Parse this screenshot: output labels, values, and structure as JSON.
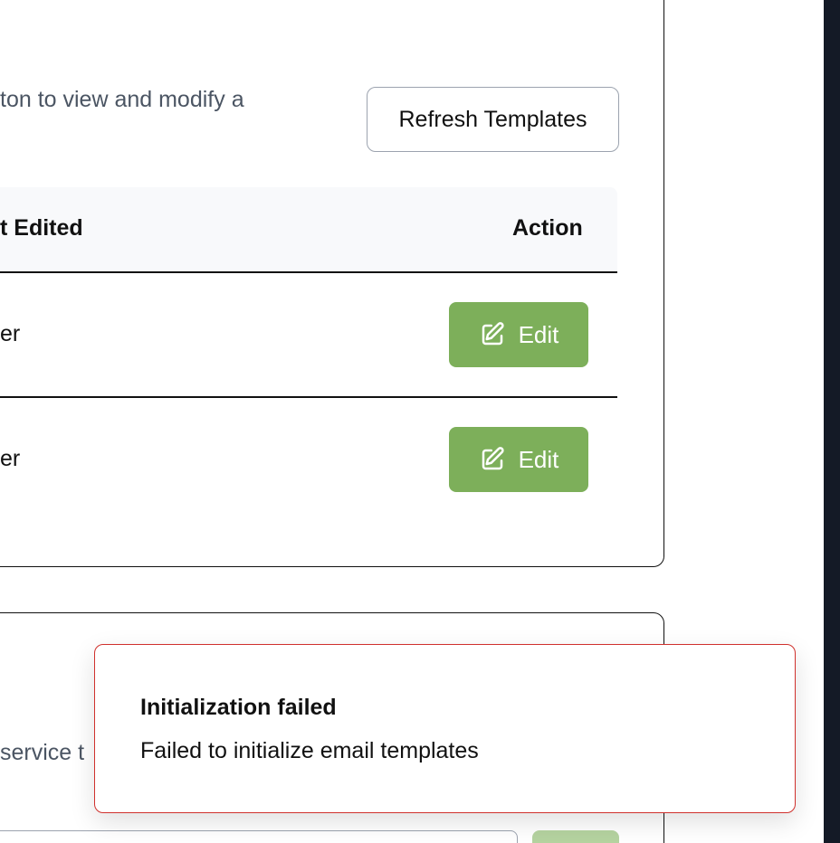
{
  "templates_card": {
    "description": "ton to view and modify a",
    "refresh_label": "Refresh Templates",
    "table": {
      "headers": {
        "last_edited": "t Edited",
        "action": "Action"
      },
      "rows": [
        {
          "last_edited": "er",
          "action_label": "Edit"
        },
        {
          "last_edited": "er",
          "action_label": "Edit"
        }
      ]
    }
  },
  "service_card": {
    "description": "service t"
  },
  "toast": {
    "title": "Initialization failed",
    "message": "Failed to initialize email templates"
  },
  "colors": {
    "edit_button": "#7daf5a",
    "toast_border": "#d0312d",
    "side_panel": "#141a26"
  },
  "icons": {
    "edit": "edit-pencil-square-icon"
  }
}
